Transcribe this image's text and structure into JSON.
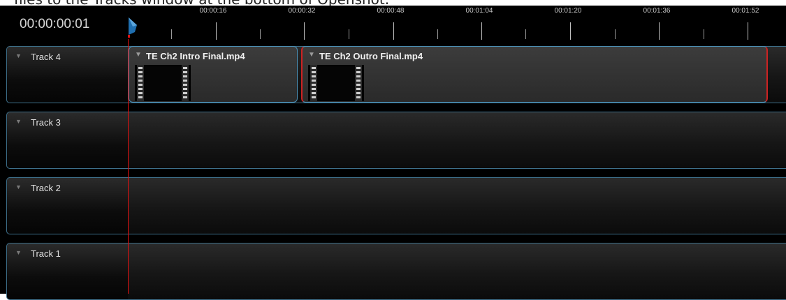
{
  "caption": "files to the Tracks window at the bottom of Openshot.",
  "timeline": {
    "timecode": "00:00:00:01",
    "ruler_labels": [
      "00:00:16",
      "00:00:32",
      "00:00:48",
      "00:01:04",
      "00:01:20",
      "00:01:36",
      "00:01:52"
    ]
  },
  "tracks": [
    {
      "label": "Track 4",
      "clips": [
        {
          "title": "TE Ch2 Intro Final.mp4"
        },
        {
          "title": "TE Ch2 Outro Final.mp4"
        }
      ]
    },
    {
      "label": "Track 3",
      "clips": []
    },
    {
      "label": "Track 2",
      "clips": []
    },
    {
      "label": "Track 1",
      "clips": []
    }
  ],
  "colors": {
    "playhead": "#dd1111",
    "track_border": "#3d6f8a",
    "clip_border": "#4a8fb5"
  },
  "icons": {
    "playhead_marker": "playhead-marker-icon",
    "collapse": "collapse-arrow-icon",
    "film": "film-strip-icon"
  }
}
